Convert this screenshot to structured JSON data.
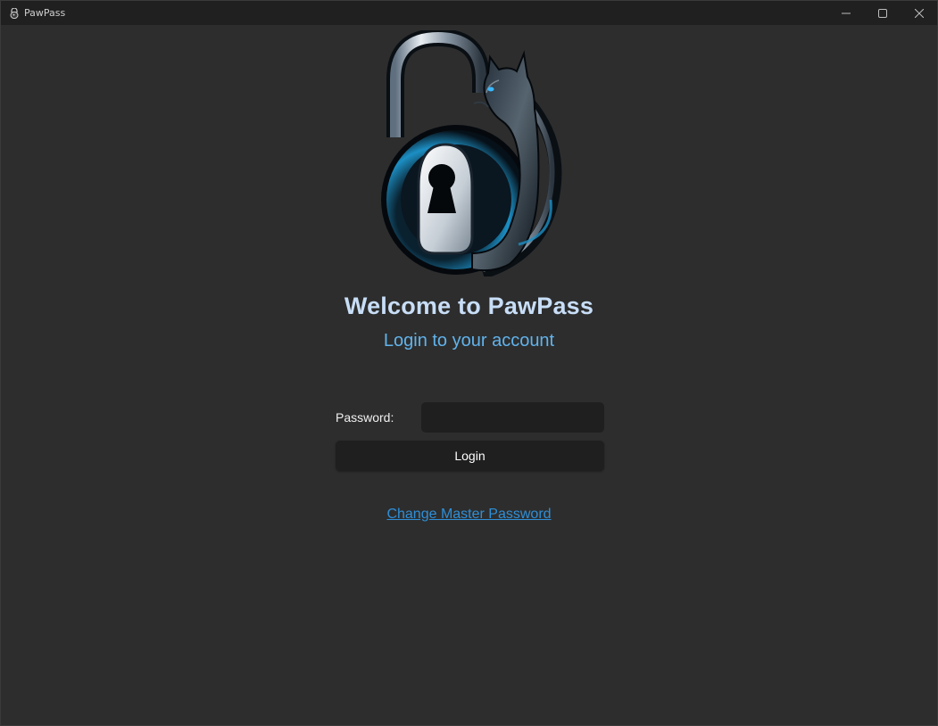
{
  "window": {
    "title": "PawPass",
    "app_icon": "pawpass-cat-lock-icon",
    "controls": [
      "minimize-icon",
      "maximize-icon",
      "close-icon"
    ]
  },
  "logo": {
    "icon": "cat-padlock-logo"
  },
  "header": {
    "welcome": "Welcome to PawPass",
    "subtitle": "Login to your account"
  },
  "form": {
    "password_label": "Password:",
    "password_value": "",
    "login_label": "Login"
  },
  "links": {
    "change_master_password": "Change Master Password"
  },
  "colors": {
    "background": "#2d2d2d",
    "titlebar": "#202020",
    "welcome_text": "#c8def7",
    "subtitle_text": "#61b3ec",
    "link": "#2f8fd8",
    "input_bg": "#1f1f1f"
  }
}
